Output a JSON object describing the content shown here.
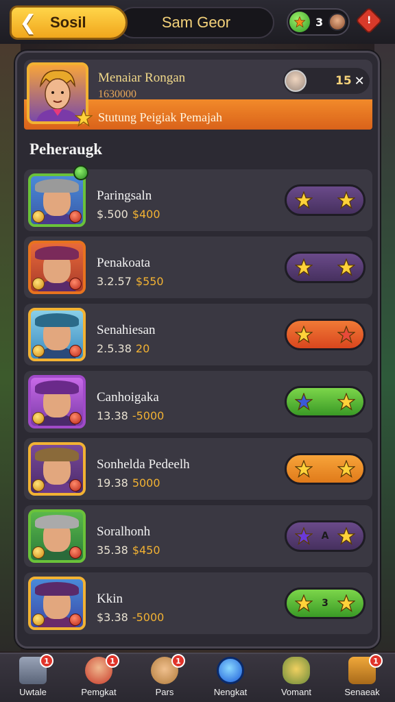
{
  "topbar": {
    "back_label": "Sosil",
    "player_name": "Sam Geor",
    "currency_value": "3"
  },
  "header": {
    "title": "Menaiar Rongan",
    "subtitle": "1630000",
    "banner": "Stutung Peigiak Pemajah",
    "level": "15"
  },
  "section_title": "Peheraugk",
  "characters": [
    {
      "name": "Paringsaln",
      "stat_a": "$.500",
      "stat_b": "$400",
      "button_color": "purple",
      "button_mid": ""
    },
    {
      "name": "Penakoata",
      "stat_a": "3.2.57",
      "stat_b": "$550",
      "button_color": "purple",
      "button_mid": ""
    },
    {
      "name": "Senahiesan",
      "stat_a": "2.5.38",
      "stat_b": "20",
      "button_color": "orange-red",
      "button_mid": ""
    },
    {
      "name": "Canhoigaka",
      "stat_a": "13.38",
      "stat_b": "-5000",
      "button_color": "green",
      "button_mid": ""
    },
    {
      "name": "Sonhelda Pedeelh",
      "stat_a": "19.38",
      "stat_b": "5000",
      "button_color": "orange",
      "button_mid": ""
    },
    {
      "name": "Soralhonh",
      "stat_a": "35.38",
      "stat_b": "$450",
      "button_color": "purple",
      "button_mid": "A"
    },
    {
      "name": "Kkin",
      "stat_a": "$3.38",
      "stat_b": "-5000",
      "button_color": "green",
      "button_mid": "3"
    }
  ],
  "bottom_nav": [
    {
      "label": "Uwtale",
      "badge": "1"
    },
    {
      "label": "Pemgkat",
      "badge": "1"
    },
    {
      "label": "Pars",
      "badge": "1"
    },
    {
      "label": "Nengkat",
      "badge": ""
    },
    {
      "label": "Vomant",
      "badge": ""
    },
    {
      "label": "Senaeak",
      "badge": "1"
    }
  ],
  "colors": {
    "accent_gold": "#f2b233",
    "header_orange": "#e8731f",
    "panel_bg": "#2c2a33"
  }
}
